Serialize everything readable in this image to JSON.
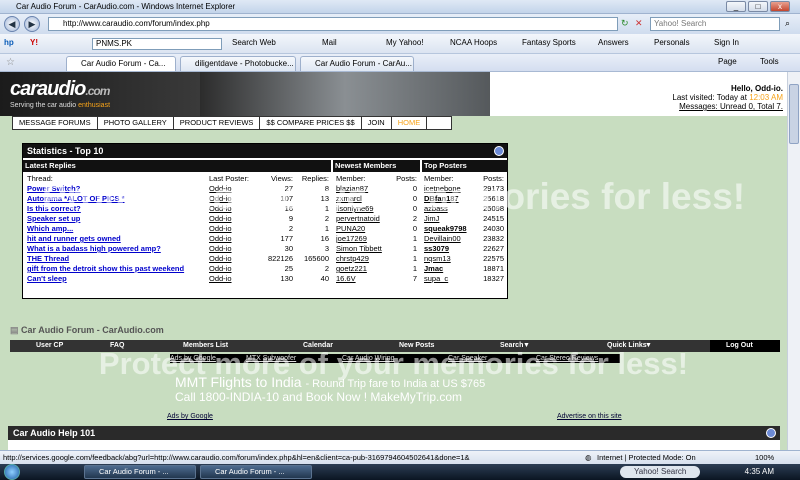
{
  "window": {
    "title": "Car Audio Forum - CarAudio.com - Windows Internet Explorer"
  },
  "address": {
    "url": "http://www.caraudio.com/forum/index.php",
    "search_placeholder": "Yahoo! Search"
  },
  "yahoo_toolbar": {
    "search_value": "PNMS.PK",
    "items": [
      "Search Web",
      "Mail",
      "My Yahoo!",
      "NCAA Hoops",
      "Fantasy Sports",
      "Answers",
      "Personals",
      "Sign In"
    ]
  },
  "tabs": [
    "Car Audio Forum - Ca...",
    "diligentdave - Photobucke...",
    "Car Audio Forum - CarAu..."
  ],
  "tab_tools": [
    "Page",
    "Tools"
  ],
  "site": {
    "logo": "caraudio",
    "logo_suffix": ".com",
    "tagline": "Serving the car audio",
    "tagline_accent": "enthusiast",
    "greeting": "Hello, Odd-io.",
    "last_visited": "Last visited: Today at",
    "last_visited_time": "12:03 AM",
    "messages": "Messages: Unread 0, Total 7.",
    "menu": [
      "MESSAGE FORUMS",
      "PHOTO GALLERY",
      "PRODUCT REVIEWS",
      "$$ COMPARE PRICES $$",
      "JOIN",
      "HOME"
    ]
  },
  "stats": {
    "title": "Statistics - Top 10",
    "latest_header": "Latest Replies",
    "newest_header": "Newest Members",
    "posters_header": "Top Posters",
    "cols": {
      "thread": "Thread:",
      "last_poster": "Last Poster:",
      "views": "Views:",
      "replies": "Replies:",
      "member": "Member:",
      "posts": "Posts:"
    },
    "threads": [
      {
        "t": "Power Switch?",
        "p": "Odd-io",
        "v": "27",
        "r": "8"
      },
      {
        "t": "Autorama *ALOT OF PICS *",
        "p": "Odd-io",
        "v": "107",
        "r": "13"
      },
      {
        "t": "Is this correct?",
        "p": "Odd-io",
        "v": "16",
        "r": "1"
      },
      {
        "t": "Speaker set up",
        "p": "Odd-io",
        "v": "9",
        "r": "2"
      },
      {
        "t": "Which amp...",
        "p": "Odd-io",
        "v": "2",
        "r": "1"
      },
      {
        "t": "hit and runner gets owned",
        "p": "Odd-io",
        "v": "177",
        "r": "16"
      },
      {
        "t": "What is a badass high powered amp?",
        "p": "Odd-io",
        "v": "30",
        "r": "3"
      },
      {
        "t": "THE Thread",
        "p": "Odd-io",
        "v": "822126",
        "r": "165600"
      },
      {
        "t": "gift from the detroit show this past weekend",
        "p": "Odd-io",
        "v": "25",
        "r": "2"
      },
      {
        "t": "Can't sleep",
        "p": "Odd-io",
        "v": "130",
        "r": "40"
      }
    ],
    "members": [
      {
        "m": "blazian87",
        "p": "0"
      },
      {
        "m": "zxmarcl",
        "p": "0"
      },
      {
        "m": "ilsonlyne69",
        "p": "0"
      },
      {
        "m": "pervertnatoid",
        "p": "2"
      },
      {
        "m": "PUNA20",
        "p": "0"
      },
      {
        "m": "joe17269",
        "p": "1"
      },
      {
        "m": "Simon Tibbett",
        "p": "1"
      },
      {
        "m": "chrstp429",
        "p": "1"
      },
      {
        "m": "goetz221",
        "p": "1"
      },
      {
        "m": "16.6V",
        "p": "7"
      }
    ],
    "posters": [
      {
        "m": "icetnebone",
        "p": "29173"
      },
      {
        "m": "DBfan187",
        "p": "25618"
      },
      {
        "m": "azbass",
        "p": "25098"
      },
      {
        "m": "JimJ",
        "p": "24515"
      },
      {
        "m": "squeak9798",
        "p": "24030"
      },
      {
        "m": "Devillain00",
        "p": "23832"
      },
      {
        "m": "ss3079",
        "p": "22627"
      },
      {
        "m": "nqsm13",
        "p": "22575"
      },
      {
        "m": "Jmac",
        "p": "18871"
      },
      {
        "m": "supa_c",
        "p": "18327"
      }
    ]
  },
  "watermark": "Protect more of your memories for less!",
  "forum": {
    "title": "Car Audio Forum - CarAudio.com",
    "nav": [
      "User CP",
      "FAQ",
      "Members List",
      "Calendar",
      "New Posts",
      "Search",
      "Quick Links",
      "Log Out"
    ],
    "ad_links": [
      "Ads by Google",
      "MTX Subwoofer",
      "Car Audio Wiring",
      "Car Speaker",
      "Car Stereo Reviews"
    ],
    "ad_title": "MMT Flights to India",
    "ad_title_rest": "- Round Trip fare to India at US $765",
    "ad_line2": "Call 1800-INDIA-10 and Book Now ! MakeMyTrip.com",
    "ads_by_google": "Ads by Google",
    "advertise": "Advertise on this site",
    "help_title": "Car Audio Help 101"
  },
  "status": {
    "url": "http://services.google.com/feedback/abg?url=http://www.caraudio.com/forum/index.php&hl=en&client=ca-pub-3169794604502641&done=1&",
    "zone": "Internet | Protected Mode: On",
    "zoom": "100%"
  },
  "taskbar": {
    "task1": "Car Audio Forum - ...",
    "task2": "Car Audio Forum - ...",
    "yahoo": "Yahoo! Search",
    "time": "4:35 AM"
  }
}
